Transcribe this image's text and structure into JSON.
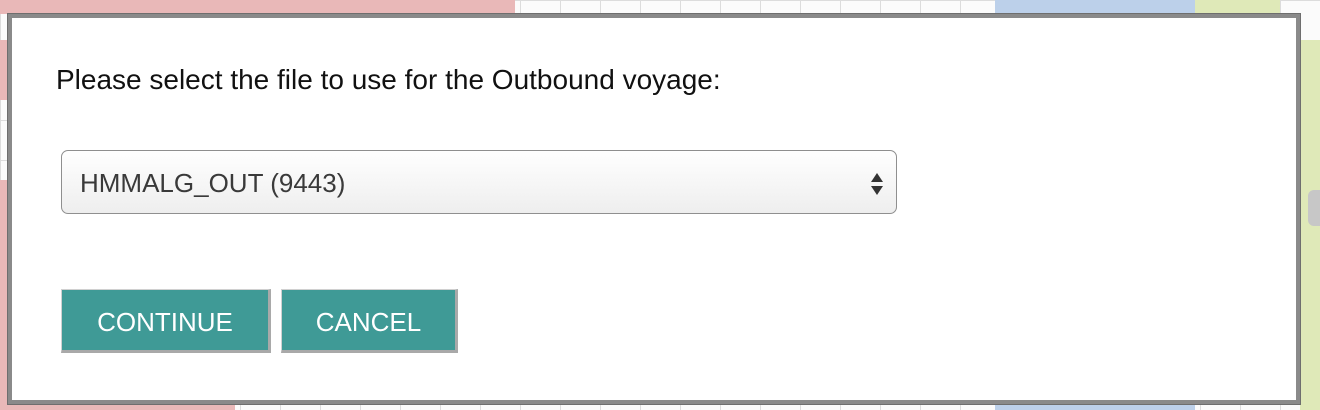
{
  "dialog": {
    "prompt": "Please select the file to use for the Outbound voyage:",
    "file_select": {
      "selected": "HMMALG_OUT (9443)"
    },
    "buttons": {
      "continue_label": "CONTINUE",
      "cancel_label": "CANCEL"
    }
  },
  "colors": {
    "button": "#3f9a96",
    "modal_border": "#8a8a8a"
  }
}
